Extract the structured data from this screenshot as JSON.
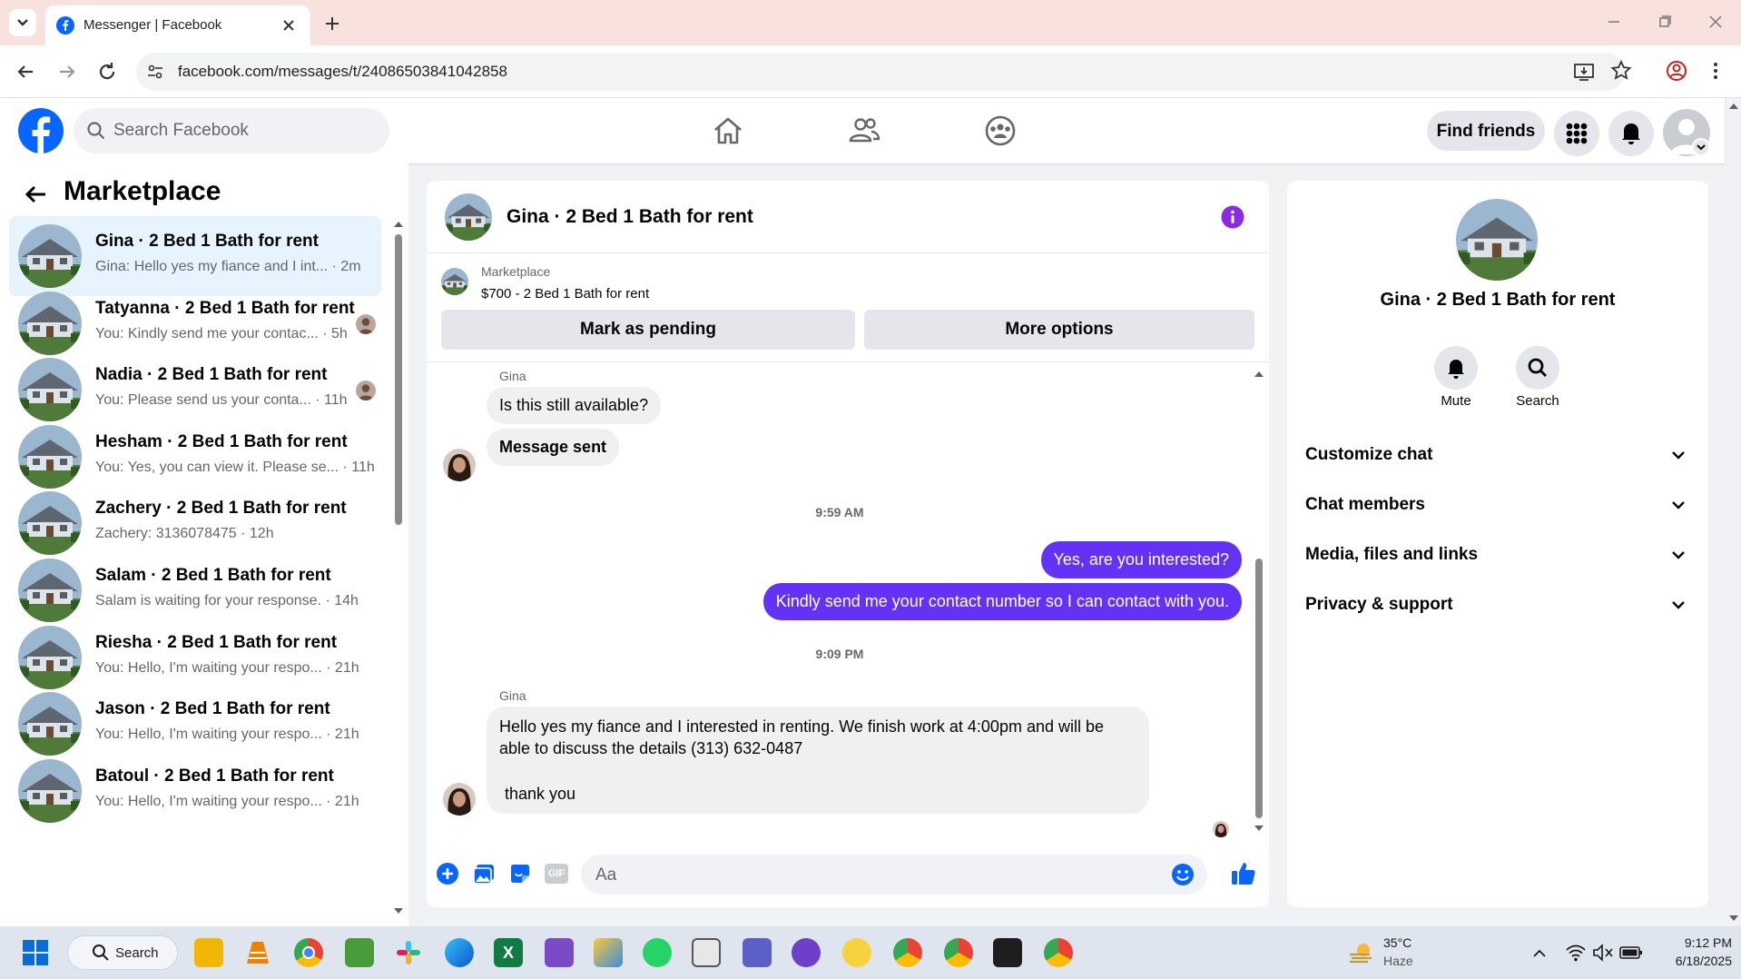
{
  "browser": {
    "tab_title": "Messenger | Facebook",
    "url": "facebook.com/messages/t/24086503841042858"
  },
  "header": {
    "search_placeholder": "Search Facebook",
    "find_friends": "Find friends"
  },
  "sidebar": {
    "title": "Marketplace",
    "conversations": [
      {
        "name": "Gina · 2 Bed 1 Bath for rent",
        "preview": "Gina: Hello yes my fiance and I int...",
        "time": "2m",
        "active": true
      },
      {
        "name": "Tatyanna · 2 Bed 1 Bath for rent",
        "preview": "You: Kindly send me your contac...",
        "time": "5h"
      },
      {
        "name": "Nadia · 2 Bed 1 Bath for rent",
        "preview": "You: Please send us your conta...",
        "time": "11h"
      },
      {
        "name": "Hesham · 2 Bed 1 Bath for rent",
        "preview": "You: Yes, you can view it. Please se...",
        "time": "11h"
      },
      {
        "name": "Zachery · 2 Bed 1 Bath for rent",
        "preview": "Zachery: 3136078475",
        "time": "12h"
      },
      {
        "name": "Salam · 2 Bed 1 Bath for rent",
        "preview": "Salam is waiting for your response.",
        "time": "14h"
      },
      {
        "name": "Riesha · 2 Bed 1 Bath for rent",
        "preview": "You: Hello, I'm waiting your respo...",
        "time": "21h"
      },
      {
        "name": "Jason · 2 Bed 1 Bath for rent",
        "preview": "You: Hello, I'm waiting your respo...",
        "time": "21h"
      },
      {
        "name": "Batoul · 2 Bed 1 Bath for rent",
        "preview": "You: Hello, I'm waiting your respo...",
        "time": "21h"
      }
    ]
  },
  "chat": {
    "title": "Gina · 2 Bed 1 Bath for rent",
    "listing_source": "Marketplace",
    "listing_title": "$700 - 2 Bed 1 Bath for rent",
    "mark_pending": "Mark as pending",
    "more_options": "More options",
    "sender_name": "Gina",
    "msg1": "Is this still available?",
    "msg2": "Message sent",
    "time1": "9:59 AM",
    "out1": "Yes, are you interested?",
    "out2": "Kindly send me your contact number so I can contact with you.",
    "time2": "9:09 PM",
    "msg3_line1": "Hello yes my fiance and I interested in renting. We finish work at 4:00pm and will be",
    "msg3_line2": "able to discuss the details (313) 632-0487",
    "msg3_line3": "thank you",
    "composer_placeholder": "Aa",
    "gif_label": "GIF"
  },
  "details": {
    "title": "Gina · 2 Bed 1 Bath for rent",
    "mute": "Mute",
    "search": "Search",
    "sections": [
      "Customize chat",
      "Chat members",
      "Media, files and links",
      "Privacy & support"
    ]
  },
  "taskbar": {
    "search": "Search",
    "weather_temp": "35°C",
    "weather_desc": "Haze",
    "time": "9:12 PM",
    "date": "6/18/2025"
  },
  "colors": {
    "fb_blue": "#0866ff",
    "messenger_purple": "#6332f5",
    "active_item": "#e7f3ff"
  }
}
